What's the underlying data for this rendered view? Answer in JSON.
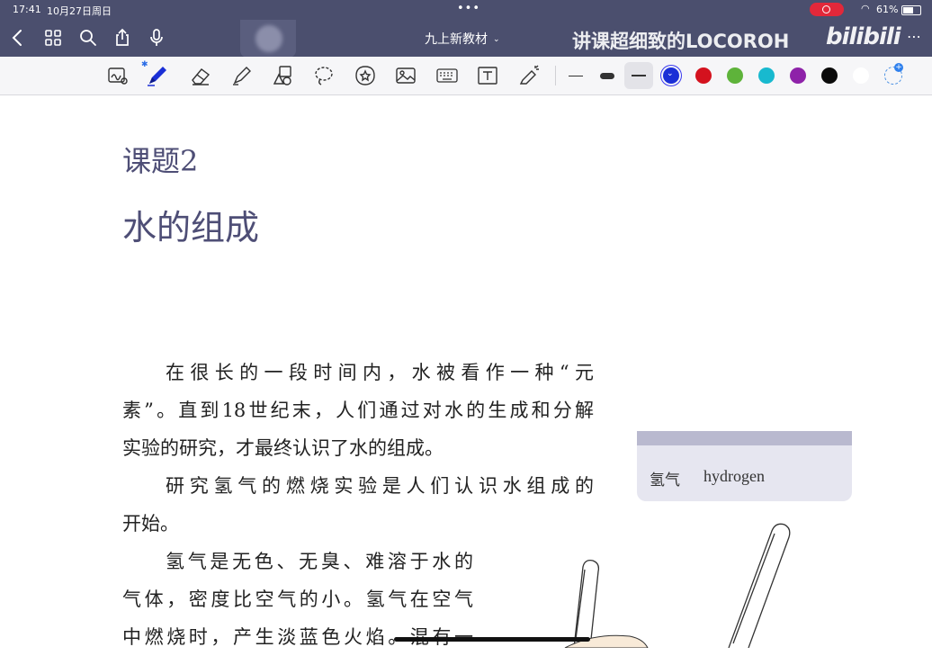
{
  "status_bar": {
    "time": "17:41",
    "date": "10月27日周日",
    "battery_pct": "61%"
  },
  "nav": {
    "title": "九上新教材",
    "icons": [
      "back-chevron-icon",
      "grid-icon",
      "search-icon",
      "share-icon",
      "microphone-icon"
    ],
    "overlay_caption": "讲课超细致的LOCOROH",
    "watermark": "bilibili"
  },
  "toolbar": {
    "tools": [
      "lasso-handwriting-icon",
      "pen-icon",
      "eraser-icon",
      "highlighter-icon",
      "shapes-icon",
      "lasso-icon",
      "sticker-icon",
      "image-icon",
      "keyboard-icon",
      "text-box-icon",
      "laser-pointer-icon"
    ],
    "colors": [
      "#1a2fd6",
      "#d4121e",
      "#5eb33a",
      "#18b9cf",
      "#8e22a9",
      "#0b0b0b",
      "#ffffff"
    ],
    "selected_color": "#1a2fd6"
  },
  "document": {
    "section_label": "课题2",
    "title": "水的组成",
    "p1": [
      "在很长的一段时间内，水被看作一种“元",
      "素”。直到18世纪末，人们通过对水的生成和分解",
      "实验的研究，才最终认识了水的组成。"
    ],
    "p2": [
      "研究氢气的燃烧实验是人们认识水组成的",
      "开始。"
    ],
    "p3": [
      "氢气是无色、无臭、难溶于水的",
      "气体，密度比空气的小。氢气在空气",
      "中燃烧时，产生淡蓝色火焰。混有一"
    ],
    "glossary": {
      "zh": "氢气",
      "en": "hydrogen"
    }
  }
}
